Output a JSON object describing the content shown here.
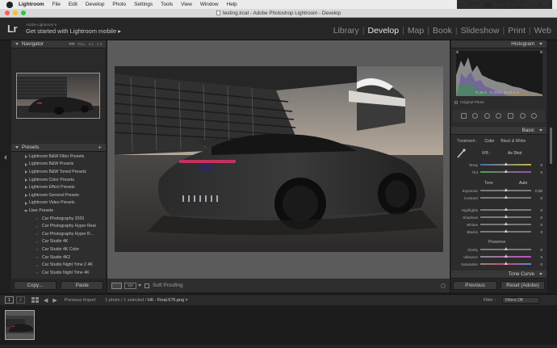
{
  "menubar": {
    "app": "Lightroom",
    "items": [
      "File",
      "Edit",
      "Develop",
      "Photo",
      "Settings",
      "Tools",
      "View",
      "Window",
      "Help"
    ],
    "battery": "100%",
    "datetime": "Wed Nov 11  2:49:31 AM"
  },
  "window": {
    "title": "testing.lrcat - Adobe Photoshop Lightroom - Develop"
  },
  "identity": {
    "logo": "Lr",
    "sub": "Adobe Lightroom 6",
    "main": "Get started with Lightroom mobile",
    "arrow": "▸"
  },
  "modules": [
    "Library",
    "Develop",
    "Map",
    "Book",
    "Slideshow",
    "Print",
    "Web"
  ],
  "navigator": {
    "title": "Navigator",
    "zoom": [
      "FIT",
      "FILL",
      "1:1",
      "1:3"
    ]
  },
  "presets": {
    "title": "Presets",
    "plus": "+",
    "folders": [
      "Lightroom B&W Filter Presets",
      "Lightroom B&W Presets",
      "Lightroom B&W Toned Presets",
      "Lightroom Color Presets",
      "Lightroom Effect Presets",
      "Lightroom General Presets",
      "Lightroom Video Presets",
      "User Presets"
    ],
    "user_presets": [
      "Car Photography 2020",
      "Car Photography Hyper Real",
      "Car Photography Hyper R...",
      "Car Studio 4K",
      "Car Studio 4K Color",
      "Car Studio 4K2",
      "Car Studio Night Time 2 4K",
      "Car Studio Night Time 4K"
    ]
  },
  "left_buttons": {
    "copy": "Copy...",
    "paste": "Paste"
  },
  "toolbar": {
    "soft_proofing": "Soft Proofing",
    "view_mode": "Y|Y"
  },
  "histogram": {
    "title": "Histogram",
    "r_label": "R",
    "r": "25.2",
    "g_label": "G",
    "g": "25.0",
    "b_label": "B",
    "b": "24.4 %",
    "original_photo": "Original Photo"
  },
  "basic": {
    "title": "Basic",
    "treatment_label": "Treatment :",
    "color": "Color",
    "bw": "Black & White",
    "wb_label": "WB :",
    "wb_value": "As Shot",
    "temp": {
      "label": "Temp",
      "value": "0",
      "pos": 0.5
    },
    "tint": {
      "label": "Tint",
      "value": "0",
      "pos": 0.5
    },
    "tone_label": "Tone",
    "auto": "Auto",
    "exposure": {
      "label": "Exposure",
      "value": "0.00",
      "pos": 0.5
    },
    "contrast": {
      "label": "Contrast",
      "value": "0",
      "pos": 0.5
    },
    "highlights": {
      "label": "Highlights",
      "value": "0",
      "pos": 0.5
    },
    "shadows": {
      "label": "Shadows",
      "value": "0",
      "pos": 0.5
    },
    "whites": {
      "label": "Whites",
      "value": "0",
      "pos": 0.5
    },
    "blacks": {
      "label": "Blacks",
      "value": "0",
      "pos": 0.5
    },
    "presence_label": "Presence",
    "clarity": {
      "label": "Clarity",
      "value": "0",
      "pos": 0.5
    },
    "vibrance": {
      "label": "Vibrance",
      "value": "0",
      "pos": 0.5
    },
    "saturation": {
      "label": "Saturation",
      "value": "0",
      "pos": 0.5
    }
  },
  "tone_curve": {
    "title": "Tone Curve"
  },
  "right_buttons": {
    "previous": "Previous",
    "reset": "Reset (Adobe)"
  },
  "filmstrip": {
    "monitor1": "1",
    "monitor2": "2",
    "prev_import": "Previous Import",
    "count": "1 photo / 1 selected /",
    "filename": "H6 - Final.675.png",
    "filename_arrow": "▾",
    "filter_label": "Filter :",
    "filter_value": "Filters Off"
  },
  "colors": {
    "panel": "#2b2b2b",
    "center": "#5b5b5b",
    "active_module": "#e6e6e6",
    "inactive_module": "#8e8e8e"
  }
}
